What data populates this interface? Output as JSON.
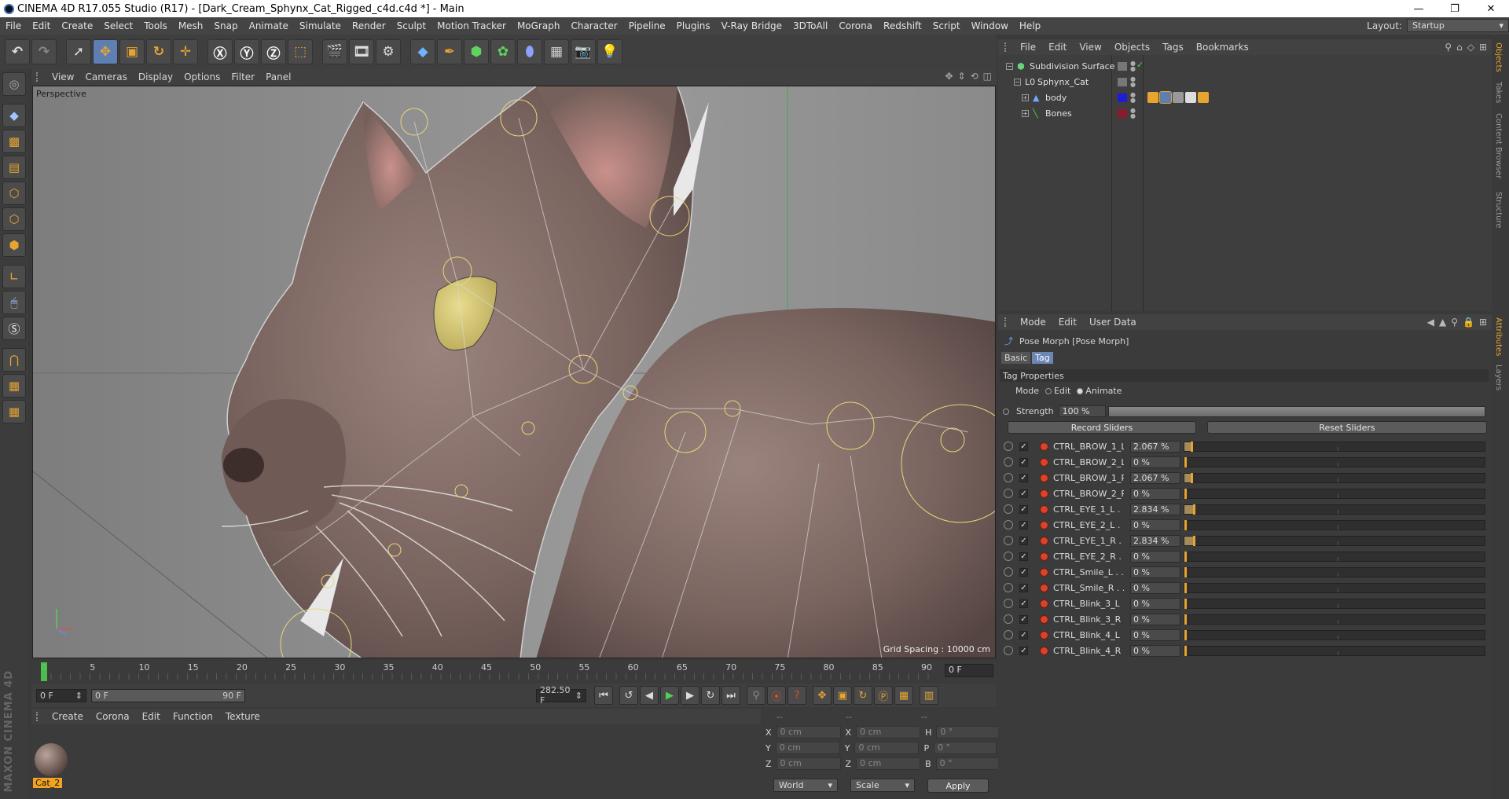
{
  "app": {
    "title": "CINEMA 4D R17.055 Studio (R17) - [Dark_Cream_Sphynx_Cat_Rigged_c4d.c4d *] - Main",
    "window_controls": [
      "—",
      "❐",
      "✕"
    ]
  },
  "menubar": {
    "items": [
      "File",
      "Edit",
      "Create",
      "Select",
      "Tools",
      "Mesh",
      "Snap",
      "Animate",
      "Simulate",
      "Render",
      "Sculpt",
      "Motion Tracker",
      "MoGraph",
      "Character",
      "Pipeline",
      "Plugins",
      "V-Ray Bridge",
      "3DToAll",
      "Corona",
      "Redshift",
      "Script",
      "Window",
      "Help"
    ],
    "layout_label": "Layout:",
    "layout_value": "Startup"
  },
  "viewport": {
    "menu": [
      "View",
      "Cameras",
      "Display",
      "Options",
      "Filter",
      "Panel"
    ],
    "camera_label": "Perspective",
    "grid_spacing": "Grid Spacing : 10000 cm"
  },
  "timeline": {
    "ticks": [
      "0",
      "5",
      "10",
      "15",
      "20",
      "25",
      "30",
      "35",
      "40",
      "45",
      "50",
      "55",
      "60",
      "65",
      "70",
      "75",
      "80",
      "85",
      "90"
    ],
    "current_frame": "0 F",
    "start_field": "0 F",
    "range_start": "0 F",
    "range_end": "90 F",
    "end_field": "282.50 F"
  },
  "materials": {
    "menu": [
      "Create",
      "Corona",
      "Edit",
      "Function",
      "Texture"
    ],
    "items": [
      {
        "name": "Cat_2"
      }
    ]
  },
  "coordinates": {
    "header": [
      "--",
      "--",
      "--"
    ],
    "rows": [
      {
        "a": "X",
        "av": "0 cm",
        "b": "X",
        "bv": "0 cm",
        "c": "H",
        "cv": "0 °"
      },
      {
        "a": "Y",
        "av": "0 cm",
        "b": "Y",
        "bv": "0 cm",
        "c": "P",
        "cv": "0 °"
      },
      {
        "a": "Z",
        "av": "0 cm",
        "b": "Z",
        "bv": "0 cm",
        "c": "B",
        "cv": "0 °"
      }
    ],
    "space": "World",
    "mode": "Scale",
    "apply": "Apply"
  },
  "objects": {
    "menu": [
      "File",
      "Edit",
      "View",
      "Objects",
      "Tags",
      "Bookmarks"
    ],
    "tree": [
      {
        "name": "Subdivision Surface",
        "indent": 0,
        "expand": "−",
        "icon": "⬢",
        "icon_color": "#67d37d"
      },
      {
        "name": "Sphynx_Cat",
        "indent": 1,
        "expand": "−",
        "icon": "L0",
        "icon_color": "#dddddd"
      },
      {
        "name": "body",
        "indent": 2,
        "expand": "+",
        "icon": "▲",
        "icon_color": "#6fa8ff",
        "color": "#1d1dd6"
      },
      {
        "name": "Bones",
        "indent": 2,
        "expand": "+",
        "icon": "╲",
        "icon_color": "#4fd24f",
        "color": "#8a1b2c"
      }
    ]
  },
  "attributes": {
    "menu": [
      "Mode",
      "Edit",
      "User Data"
    ],
    "title": "Pose Morph [Pose Morph]",
    "tabs": [
      "Basic",
      "Tag"
    ],
    "section": "Tag Properties",
    "mode_label": "Mode",
    "mode_edit": "Edit",
    "mode_animate": "Animate",
    "strength_label": "Strength",
    "strength_value": "100 %",
    "record_sliders": "Record Sliders",
    "reset_sliders": "Reset Sliders",
    "sliders": [
      {
        "name": "CTRL_BROW_1_L",
        "value": "2.067 %",
        "pct": 2.067
      },
      {
        "name": "CTRL_BROW_2_L",
        "value": "0 %",
        "pct": 0
      },
      {
        "name": "CTRL_BROW_1_R",
        "value": "2.067 %",
        "pct": 2.067
      },
      {
        "name": "CTRL_BROW_2_R",
        "value": "0 %",
        "pct": 0
      },
      {
        "name": "CTRL_EYE_1_L . .",
        "value": "2.834 %",
        "pct": 2.834
      },
      {
        "name": "CTRL_EYE_2_L . .",
        "value": "0 %",
        "pct": 0
      },
      {
        "name": "CTRL_EYE_1_R . .",
        "value": "2.834 %",
        "pct": 2.834
      },
      {
        "name": "CTRL_EYE_2_R . .",
        "value": "0 %",
        "pct": 0
      },
      {
        "name": "CTRL_Smile_L . . .",
        "value": "0 %",
        "pct": 0
      },
      {
        "name": "CTRL_Smile_R . . .",
        "value": "0 %",
        "pct": 0
      },
      {
        "name": "CTRL_Blink_3_L",
        "value": "0 %",
        "pct": 0
      },
      {
        "name": "CTRL_Blink_3_R",
        "value": "0 %",
        "pct": 0
      },
      {
        "name": "CTRL_Blink_4_L",
        "value": "0 %",
        "pct": 0
      },
      {
        "name": "CTRL_Blink_4_R",
        "value": "0 %",
        "pct": 0
      }
    ]
  },
  "side_tabs": [
    "Objects",
    "Takes",
    "Content Browser",
    "Structure",
    "Attributes",
    "Layers"
  ],
  "brand": "MAXON CINEMA 4D"
}
